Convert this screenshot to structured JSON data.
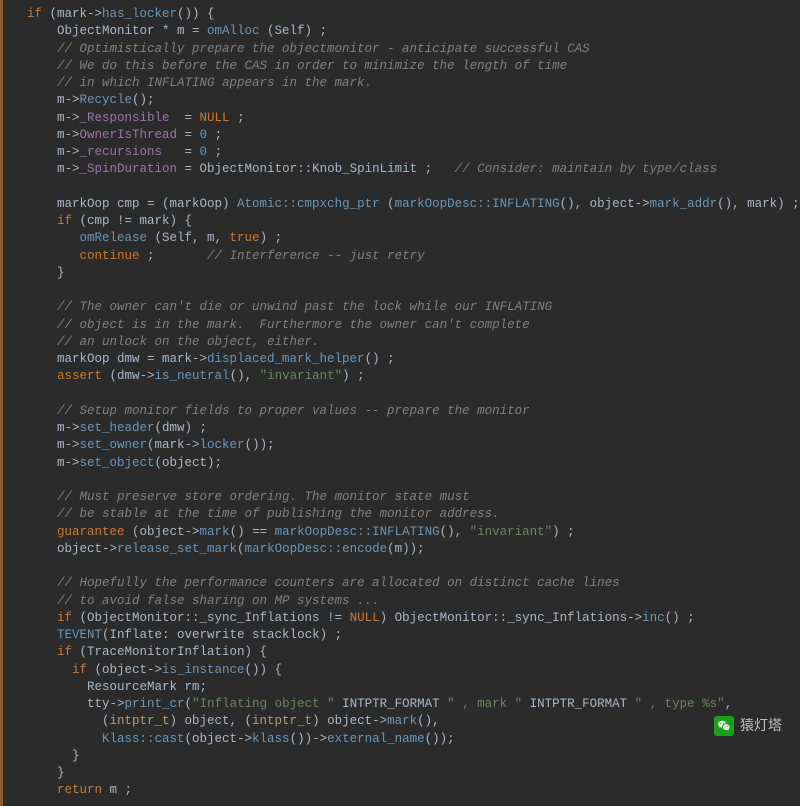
{
  "code": {
    "l1a": "if",
    "l1b": " (mark->",
    "l1c": "has_locker",
    "l1d": "()) {",
    "l2a": "    ObjectMonitor * m = ",
    "l2b": "omAlloc",
    "l2c": " (Self) ;",
    "l3": "    // Optimistically prepare the objectmonitor - anticipate successful CAS",
    "l4": "    // We do this before the CAS in order to minimize the length of time",
    "l5": "    // in which INFLATING appears in the mark.",
    "l6a": "    m->",
    "l6b": "Recycle",
    "l6c": "();",
    "l7a": "    m->",
    "l7b": "_Responsible",
    "l7c": "  = ",
    "l7d": "NULL",
    "l7e": " ;",
    "l8a": "    m->",
    "l8b": "OwnerIsThread",
    "l8c": " = ",
    "l8d": "0",
    "l8e": " ;",
    "l9a": "    m->",
    "l9b": "_recursions",
    "l9c": "   = ",
    "l9d": "0",
    "l9e": " ;",
    "l10a": "    m->",
    "l10b": "_SpinDuration",
    "l10c": " = ObjectMonitor::Knob_SpinLimit ;   ",
    "l10d": "// Consider: maintain by type/class",
    "blank": "",
    "l12a": "    markOop cmp = (markOop) ",
    "l12b": "Atomic::cmpxchg_ptr",
    "l12c": " (",
    "l12d": "markOopDesc::INFLATING",
    "l12e": "(), object->",
    "l12f": "mark_addr",
    "l12g": "(), mark) ;",
    "l13a": "    if",
    "l13b": " (cmp != mark) {",
    "l14a": "       ",
    "l14b": "omRelease",
    "l14c": " (Self, m, ",
    "l14d": "true",
    "l14e": ") ;",
    "l15a": "       ",
    "l15b": "continue",
    "l15c": " ;       ",
    "l15d": "// Interference -- just retry",
    "l16": "    }",
    "l18": "    // The owner can't die or unwind past the lock while our INFLATING",
    "l19": "    // object is in the mark.  Furthermore the owner can't complete",
    "l20": "    // an unlock on the object, either.",
    "l21a": "    markOop dmw = mark->",
    "l21b": "displaced_mark_helper",
    "l21c": "() ;",
    "l22a": "    ",
    "l22b": "assert",
    "l22c": " (dmw->",
    "l22d": "is_neutral",
    "l22e": "(), ",
    "l22f": "\"invariant\"",
    "l22g": ") ;",
    "l24": "    // Setup monitor fields to proper values -- prepare the monitor",
    "l25a": "    m->",
    "l25b": "set_header",
    "l25c": "(dmw) ;",
    "l26a": "    m->",
    "l26b": "set_owner",
    "l26c": "(mark->",
    "l26d": "locker",
    "l26e": "());",
    "l27a": "    m->",
    "l27b": "set_object",
    "l27c": "(object);",
    "l29": "    // Must preserve store ordering. The monitor state must",
    "l30": "    // be stable at the time of publishing the monitor address.",
    "l31a": "    ",
    "l31b": "guarantee",
    "l31c": " (object->",
    "l31d": "mark",
    "l31e": "() == ",
    "l31f": "markOopDesc::INFLATING",
    "l31g": "(), ",
    "l31h": "\"invariant\"",
    "l31i": ") ;",
    "l32a": "    object->",
    "l32b": "release_set_mark",
    "l32c": "(",
    "l32d": "markOopDesc::encode",
    "l32e": "(m));",
    "l34": "    // Hopefully the performance counters are allocated on distinct cache lines",
    "l35": "    // to avoid false sharing on MP systems ...",
    "l36a": "    if",
    "l36b": " (ObjectMonitor::_sync_Inflations != ",
    "l36c": "NULL",
    "l36d": ") ObjectMonitor::_sync_Inflations->",
    "l36e": "inc",
    "l36f": "() ;",
    "l37a": "    ",
    "l37b": "TEVENT",
    "l37c": "(Inflate: overwrite stacklock) ;",
    "l38a": "    if",
    "l38b": " (TraceMonitorInflation) {",
    "l39a": "      if",
    "l39b": " (object->",
    "l39c": "is_instance",
    "l39d": "()) {",
    "l40": "        ResourceMark rm;",
    "l41a": "        tty->",
    "l41b": "print_cr",
    "l41c": "(",
    "l41d": "\"Inflating object \"",
    "l41e": " INTPTR_FORMAT ",
    "l41f": "\" , mark \"",
    "l41g": " INTPTR_FORMAT ",
    "l41h": "\" , type %s\"",
    "l41i": ",",
    "l42a": "          (",
    "l42b": "intptr_t",
    "l42c": ") object, (",
    "l42d": "intptr_t",
    "l42e": ") object->",
    "l42f": "mark",
    "l42g": "(),",
    "l43a": "          ",
    "l43b": "Klass::cast",
    "l43c": "(object->",
    "l43d": "klass",
    "l43e": "())->",
    "l43f": "external_name",
    "l43g": "());",
    "l44": "      }",
    "l45": "    }",
    "l46a": "    return",
    "l46b": " m ;"
  },
  "watermark": {
    "label": "猿灯塔"
  }
}
